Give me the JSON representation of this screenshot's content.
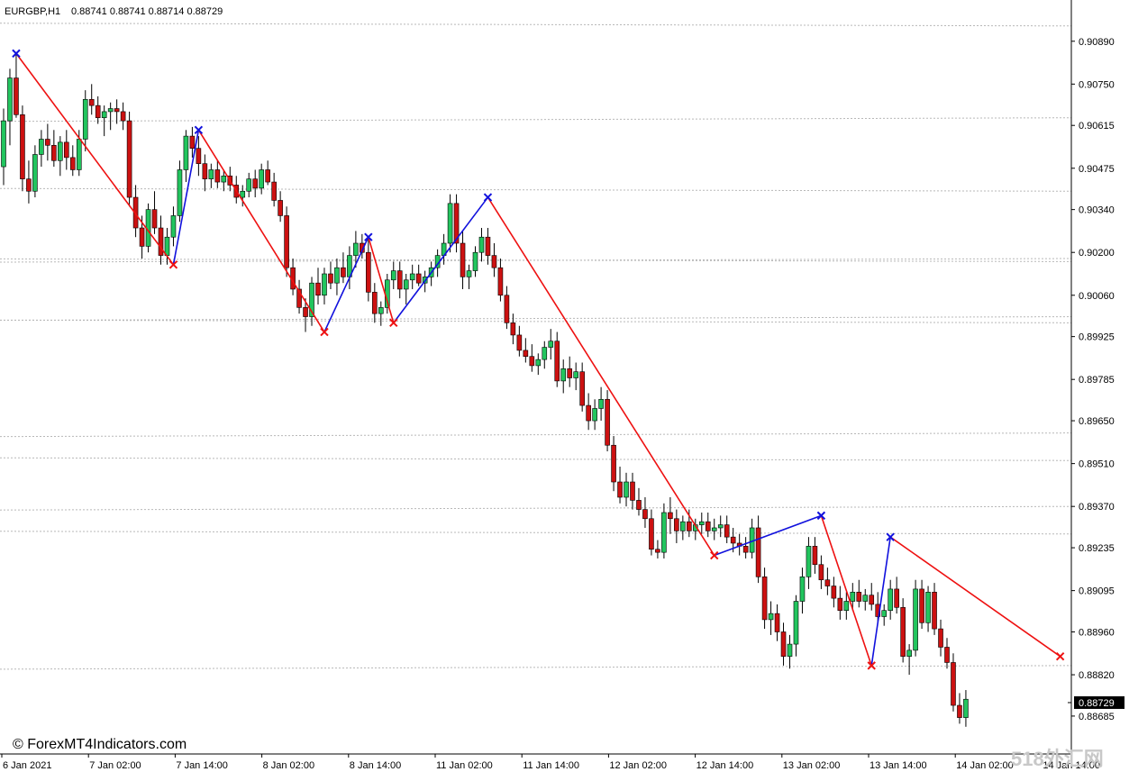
{
  "window": {
    "symbol_label": "EURGBP,H1",
    "ohlc_label": "0.88741 0.88741 0.88714 0.88729"
  },
  "watermark": "© ForexMT4Indicators.com",
  "corner_watermark": "518外汇网",
  "colors": {
    "bull": "#22c55e",
    "bear": "#cc1111",
    "wick": "#000000",
    "zigzag_down": "#ee1111",
    "zigzag_up": "#1111dd",
    "grid": "#b8b8b8",
    "price_tag_bg": "#000000",
    "price_tag_fg": "#ffffff"
  },
  "chart_data": {
    "type": "candlestick",
    "timeframe": "H1",
    "ylim": [
      0.8862,
      0.9096
    ],
    "y_ticks": [
      "0.90890",
      "0.90750",
      "0.90615",
      "0.90475",
      "0.90340",
      "0.90200",
      "0.90060",
      "0.89925",
      "0.89785",
      "0.89650",
      "0.89510",
      "0.89370",
      "0.89235",
      "0.89095",
      "0.88960",
      "0.88820",
      "0.88685"
    ],
    "x_ticks": [
      "6 Jan 2021",
      "7 Jan 02:00",
      "7 Jan 14:00",
      "8 Jan 02:00",
      "8 Jan 14:00",
      "11 Jan 02:00",
      "11 Jan 14:00",
      "12 Jan 02:00",
      "12 Jan 14:00",
      "13 Jan 02:00",
      "13 Jan 14:00",
      "14 Jan 02:00",
      "14 Jan 14:00"
    ],
    "current_price": "0.88729",
    "zigzag": [
      {
        "bar": 2,
        "price": 0.9085
      },
      {
        "bar": 27,
        "price": 0.9016
      },
      {
        "bar": 31,
        "price": 0.906
      },
      {
        "bar": 51,
        "price": 0.8994
      },
      {
        "bar": 58,
        "price": 0.9025
      },
      {
        "bar": 62,
        "price": 0.8997
      },
      {
        "bar": 77,
        "price": 0.9038
      },
      {
        "bar": 113,
        "price": 0.8921
      },
      {
        "bar": 130,
        "price": 0.8934
      },
      {
        "bar": 138,
        "price": 0.8885
      },
      {
        "bar": 141,
        "price": 0.8927
      },
      {
        "bar": 168,
        "price": 0.8888
      }
    ],
    "levels": [
      0.9094,
      0.9064,
      0.904,
      0.9018,
      0.9017,
      0.8999,
      0.8997,
      0.8961,
      0.8952,
      0.8937,
      0.8928,
      0.8885
    ],
    "candles": [
      [
        0.9048,
        0.9067,
        0.9042,
        0.9063
      ],
      [
        0.9063,
        0.908,
        0.9055,
        0.9077
      ],
      [
        0.9077,
        0.9085,
        0.9064,
        0.9065
      ],
      [
        0.9065,
        0.9068,
        0.904,
        0.9044
      ],
      [
        0.9044,
        0.905,
        0.9036,
        0.904
      ],
      [
        0.904,
        0.9055,
        0.9038,
        0.9052
      ],
      [
        0.9052,
        0.906,
        0.9048,
        0.9057
      ],
      [
        0.9057,
        0.9062,
        0.905,
        0.9055
      ],
      [
        0.9055,
        0.906,
        0.9048,
        0.905
      ],
      [
        0.905,
        0.9058,
        0.9045,
        0.9056
      ],
      [
        0.9056,
        0.906,
        0.9047,
        0.9051
      ],
      [
        0.9051,
        0.9055,
        0.9045,
        0.9047
      ],
      [
        0.9047,
        0.906,
        0.9045,
        0.9057
      ],
      [
        0.9057,
        0.9073,
        0.9053,
        0.907
      ],
      [
        0.907,
        0.9075,
        0.9065,
        0.9068
      ],
      [
        0.9068,
        0.9071,
        0.9062,
        0.9064
      ],
      [
        0.9064,
        0.9068,
        0.9058,
        0.9066
      ],
      [
        0.9066,
        0.9069,
        0.906,
        0.9067
      ],
      [
        0.9067,
        0.907,
        0.9062,
        0.9066
      ],
      [
        0.9066,
        0.9069,
        0.906,
        0.9063
      ],
      [
        0.9063,
        0.9066,
        0.9035,
        0.9038
      ],
      [
        0.9038,
        0.9042,
        0.9025,
        0.9028
      ],
      [
        0.9028,
        0.9032,
        0.9018,
        0.9022
      ],
      [
        0.9022,
        0.9036,
        0.902,
        0.9034
      ],
      [
        0.9034,
        0.904,
        0.9026,
        0.9028
      ],
      [
        0.9028,
        0.9032,
        0.9016,
        0.9019
      ],
      [
        0.9019,
        0.9028,
        0.9016,
        0.9025
      ],
      [
        0.9025,
        0.9035,
        0.9022,
        0.9032
      ],
      [
        0.9032,
        0.905,
        0.903,
        0.9047
      ],
      [
        0.9047,
        0.906,
        0.9043,
        0.9058
      ],
      [
        0.9058,
        0.9061,
        0.9051,
        0.9054
      ],
      [
        0.9054,
        0.9058,
        0.9045,
        0.9049
      ],
      [
        0.9049,
        0.9052,
        0.904,
        0.9044
      ],
      [
        0.9044,
        0.9049,
        0.9041,
        0.9047
      ],
      [
        0.9047,
        0.905,
        0.9041,
        0.9043
      ],
      [
        0.9043,
        0.9047,
        0.904,
        0.9045
      ],
      [
        0.9045,
        0.9048,
        0.904,
        0.9042
      ],
      [
        0.9042,
        0.9045,
        0.9036,
        0.9038
      ],
      [
        0.9038,
        0.9042,
        0.9035,
        0.904
      ],
      [
        0.904,
        0.9046,
        0.9038,
        0.9044
      ],
      [
        0.9044,
        0.9047,
        0.9038,
        0.9041
      ],
      [
        0.9041,
        0.9049,
        0.9039,
        0.9047
      ],
      [
        0.9047,
        0.905,
        0.9042,
        0.9043
      ],
      [
        0.9043,
        0.9046,
        0.9035,
        0.9037
      ],
      [
        0.9037,
        0.904,
        0.903,
        0.9032
      ],
      [
        0.9032,
        0.9035,
        0.9012,
        0.9015
      ],
      [
        0.9015,
        0.9018,
        0.9006,
        0.9008
      ],
      [
        0.9008,
        0.9011,
        0.9,
        0.9002
      ],
      [
        0.9002,
        0.9005,
        0.8994,
        0.8999
      ],
      [
        0.8999,
        0.9012,
        0.8996,
        0.901
      ],
      [
        0.901,
        0.9015,
        0.9003,
        0.9006
      ],
      [
        0.9006,
        0.9015,
        0.9003,
        0.9013
      ],
      [
        0.9013,
        0.9017,
        0.9008,
        0.901
      ],
      [
        0.901,
        0.9018,
        0.9006,
        0.9015
      ],
      [
        0.9015,
        0.902,
        0.901,
        0.9012
      ],
      [
        0.9012,
        0.9022,
        0.9008,
        0.9019
      ],
      [
        0.9019,
        0.9027,
        0.9015,
        0.9023
      ],
      [
        0.9023,
        0.9026,
        0.9018,
        0.902
      ],
      [
        0.902,
        0.9025,
        0.9004,
        0.9007
      ],
      [
        0.9007,
        0.901,
        0.8997,
        0.9
      ],
      [
        0.9,
        0.9004,
        0.8996,
        0.9002
      ],
      [
        0.9002,
        0.9013,
        0.9,
        0.9011
      ],
      [
        0.9011,
        0.9017,
        0.9008,
        0.9014
      ],
      [
        0.9014,
        0.9017,
        0.9005,
        0.9008
      ],
      [
        0.9008,
        0.9013,
        0.9003,
        0.9011
      ],
      [
        0.9011,
        0.9016,
        0.9008,
        0.9013
      ],
      [
        0.9013,
        0.9016,
        0.9009,
        0.901
      ],
      [
        0.901,
        0.9014,
        0.9007,
        0.9012
      ],
      [
        0.9012,
        0.9017,
        0.9009,
        0.9015
      ],
      [
        0.9015,
        0.9021,
        0.9012,
        0.9019
      ],
      [
        0.9019,
        0.9026,
        0.9016,
        0.9023
      ],
      [
        0.9023,
        0.9039,
        0.902,
        0.9036
      ],
      [
        0.9036,
        0.9039,
        0.902,
        0.9023
      ],
      [
        0.9023,
        0.9027,
        0.9008,
        0.9012
      ],
      [
        0.9012,
        0.9016,
        0.9008,
        0.9014
      ],
      [
        0.9014,
        0.9022,
        0.9012,
        0.902
      ],
      [
        0.902,
        0.9028,
        0.9017,
        0.9025
      ],
      [
        0.9025,
        0.9028,
        0.9016,
        0.9019
      ],
      [
        0.9019,
        0.9023,
        0.9012,
        0.9015
      ],
      [
        0.9015,
        0.9018,
        0.9004,
        0.9006
      ],
      [
        0.9006,
        0.9009,
        0.8995,
        0.8997
      ],
      [
        0.8997,
        0.9,
        0.899,
        0.8993
      ],
      [
        0.8993,
        0.8996,
        0.8986,
        0.8988
      ],
      [
        0.8988,
        0.8992,
        0.8984,
        0.8986
      ],
      [
        0.8986,
        0.899,
        0.8981,
        0.8983
      ],
      [
        0.8983,
        0.8987,
        0.898,
        0.8985
      ],
      [
        0.8985,
        0.8991,
        0.8982,
        0.8989
      ],
      [
        0.8989,
        0.8995,
        0.8985,
        0.8991
      ],
      [
        0.8991,
        0.8994,
        0.8976,
        0.8978
      ],
      [
        0.8978,
        0.8985,
        0.8974,
        0.8982
      ],
      [
        0.8982,
        0.8986,
        0.8976,
        0.8979
      ],
      [
        0.8979,
        0.8984,
        0.8975,
        0.8981
      ],
      [
        0.8981,
        0.8984,
        0.8968,
        0.897
      ],
      [
        0.897,
        0.8974,
        0.8962,
        0.8965
      ],
      [
        0.8965,
        0.8972,
        0.8962,
        0.8969
      ],
      [
        0.8969,
        0.8976,
        0.8965,
        0.8972
      ],
      [
        0.8972,
        0.8975,
        0.8955,
        0.8957
      ],
      [
        0.8957,
        0.896,
        0.8942,
        0.8945
      ],
      [
        0.8945,
        0.895,
        0.8938,
        0.894
      ],
      [
        0.894,
        0.8948,
        0.8937,
        0.8945
      ],
      [
        0.8945,
        0.8948,
        0.8936,
        0.8939
      ],
      [
        0.8939,
        0.8943,
        0.8934,
        0.8936
      ],
      [
        0.8936,
        0.894,
        0.893,
        0.8933
      ],
      [
        0.8933,
        0.8936,
        0.8921,
        0.8923
      ],
      [
        0.8923,
        0.8926,
        0.892,
        0.8922
      ],
      [
        0.8922,
        0.8938,
        0.892,
        0.8935
      ],
      [
        0.8935,
        0.894,
        0.8928,
        0.8933
      ],
      [
        0.8933,
        0.8936,
        0.8925,
        0.8929
      ],
      [
        0.8929,
        0.8934,
        0.8926,
        0.8932
      ],
      [
        0.8932,
        0.8936,
        0.8927,
        0.8929
      ],
      [
        0.8929,
        0.8933,
        0.8926,
        0.8931
      ],
      [
        0.8931,
        0.8935,
        0.8928,
        0.8932
      ],
      [
        0.8932,
        0.8935,
        0.8927,
        0.8929
      ],
      [
        0.8929,
        0.8933,
        0.8926,
        0.893
      ],
      [
        0.893,
        0.8934,
        0.8927,
        0.8931
      ],
      [
        0.8931,
        0.8934,
        0.8925,
        0.8927
      ],
      [
        0.8927,
        0.893,
        0.8922,
        0.8925
      ],
      [
        0.8925,
        0.8928,
        0.8921,
        0.8924
      ],
      [
        0.8924,
        0.8927,
        0.892,
        0.8922
      ],
      [
        0.8922,
        0.8933,
        0.892,
        0.893
      ],
      [
        0.893,
        0.8934,
        0.8912,
        0.8914
      ],
      [
        0.8914,
        0.8917,
        0.8897,
        0.89
      ],
      [
        0.89,
        0.8906,
        0.8895,
        0.8902
      ],
      [
        0.8902,
        0.8905,
        0.8893,
        0.8896
      ],
      [
        0.8896,
        0.8899,
        0.8885,
        0.8888
      ],
      [
        0.8888,
        0.8895,
        0.8884,
        0.8892
      ],
      [
        0.8892,
        0.8908,
        0.8888,
        0.8906
      ],
      [
        0.8906,
        0.8917,
        0.8902,
        0.8914
      ],
      [
        0.8914,
        0.8927,
        0.891,
        0.8924
      ],
      [
        0.8924,
        0.8927,
        0.8915,
        0.8918
      ],
      [
        0.8918,
        0.8921,
        0.891,
        0.8913
      ],
      [
        0.8913,
        0.8917,
        0.8908,
        0.8911
      ],
      [
        0.8911,
        0.8914,
        0.8904,
        0.8907
      ],
      [
        0.8907,
        0.8911,
        0.89,
        0.8903
      ],
      [
        0.8903,
        0.8909,
        0.89,
        0.8906
      ],
      [
        0.8906,
        0.8912,
        0.8903,
        0.8909
      ],
      [
        0.8909,
        0.8913,
        0.8904,
        0.8906
      ],
      [
        0.8906,
        0.891,
        0.8903,
        0.8908
      ],
      [
        0.8908,
        0.8912,
        0.8903,
        0.8905
      ],
      [
        0.8905,
        0.8909,
        0.8899,
        0.8901
      ],
      [
        0.8901,
        0.8905,
        0.8898,
        0.8903
      ],
      [
        0.8903,
        0.8913,
        0.89,
        0.891
      ],
      [
        0.891,
        0.8914,
        0.8902,
        0.8904
      ],
      [
        0.8904,
        0.8907,
        0.8886,
        0.8888
      ],
      [
        0.8888,
        0.8892,
        0.8882,
        0.889
      ],
      [
        0.889,
        0.8913,
        0.8888,
        0.891
      ],
      [
        0.891,
        0.8913,
        0.8897,
        0.8899
      ],
      [
        0.8899,
        0.8911,
        0.8896,
        0.8909
      ],
      [
        0.8909,
        0.8912,
        0.8895,
        0.8897
      ],
      [
        0.8897,
        0.89,
        0.8888,
        0.8891
      ],
      [
        0.8891,
        0.8894,
        0.8884,
        0.8886
      ],
      [
        0.8886,
        0.8889,
        0.887,
        0.8872
      ],
      [
        0.8872,
        0.8876,
        0.8866,
        0.8868
      ],
      [
        0.8868,
        0.8877,
        0.8865,
        0.8874
      ]
    ]
  }
}
